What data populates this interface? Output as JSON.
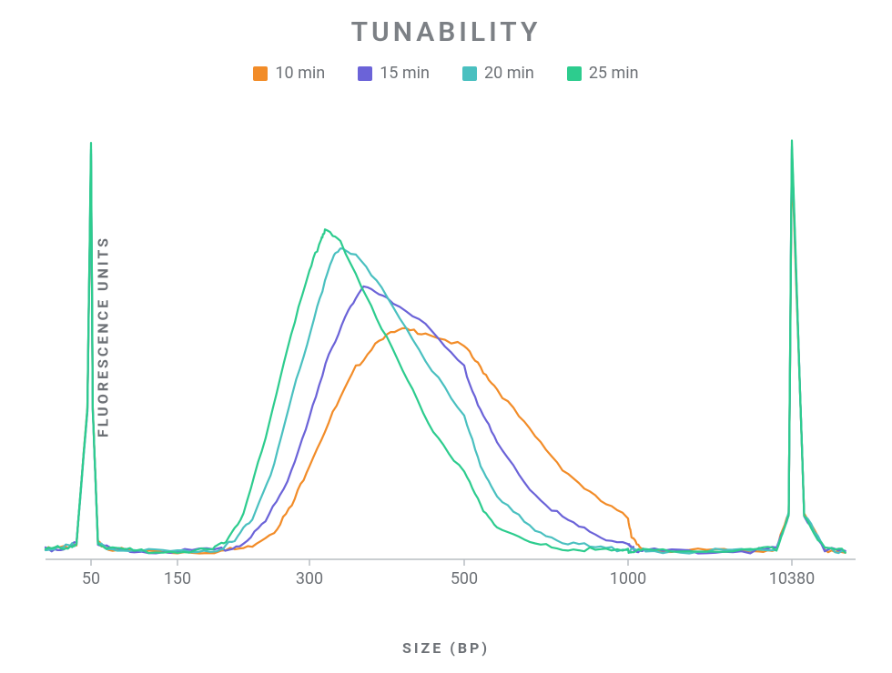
{
  "chart_data": {
    "type": "line",
    "title": "TUNABILITY",
    "xlabel": "SIZE (BP)",
    "ylabel": "FLUORESCENCE UNITS",
    "x_ticks": [
      50,
      150,
      300,
      500,
      1000,
      10380
    ],
    "x_scale_note": "x positions are approximate log-like mapping of bp size to chart x",
    "legend_position": "top",
    "y_range": [
      0,
      1.0
    ],
    "series": [
      {
        "name": "10 min",
        "color": "#f28c28",
        "peak_bp": 420,
        "peak_rel_height": 0.54,
        "data": [
          [
            25,
            0.015
          ],
          [
            35,
            0.02
          ],
          [
            42,
            0.03
          ],
          [
            48,
            0.35
          ],
          [
            50,
            0.95
          ],
          [
            52,
            0.35
          ],
          [
            58,
            0.03
          ],
          [
            70,
            0.018
          ],
          [
            100,
            0.012
          ],
          [
            150,
            0.01
          ],
          [
            200,
            0.012
          ],
          [
            230,
            0.02
          ],
          [
            260,
            0.06
          ],
          [
            280,
            0.12
          ],
          [
            300,
            0.22
          ],
          [
            330,
            0.34
          ],
          [
            360,
            0.45
          ],
          [
            390,
            0.52
          ],
          [
            420,
            0.54
          ],
          [
            450,
            0.535
          ],
          [
            500,
            0.5
          ],
          [
            550,
            0.45
          ],
          [
            600,
            0.4
          ],
          [
            700,
            0.3
          ],
          [
            800,
            0.21
          ],
          [
            900,
            0.14
          ],
          [
            1000,
            0.09
          ],
          [
            1200,
            0.05
          ],
          [
            1500,
            0.025
          ],
          [
            2000,
            0.015
          ],
          [
            5000,
            0.012
          ],
          [
            8000,
            0.012
          ],
          [
            9500,
            0.018
          ],
          [
            10200,
            0.1
          ],
          [
            10380,
            0.95
          ],
          [
            10500,
            0.1
          ],
          [
            10700,
            0.015
          ],
          [
            10900,
            0.012
          ]
        ]
      },
      {
        "name": "15 min",
        "color": "#6b63d8",
        "peak_bp": 370,
        "peak_rel_height": 0.64,
        "data": [
          [
            25,
            0.015
          ],
          [
            35,
            0.02
          ],
          [
            42,
            0.03
          ],
          [
            48,
            0.35
          ],
          [
            50,
            0.96
          ],
          [
            52,
            0.35
          ],
          [
            58,
            0.03
          ],
          [
            70,
            0.018
          ],
          [
            100,
            0.012
          ],
          [
            150,
            0.01
          ],
          [
            200,
            0.015
          ],
          [
            225,
            0.03
          ],
          [
            250,
            0.08
          ],
          [
            275,
            0.18
          ],
          [
            300,
            0.33
          ],
          [
            325,
            0.48
          ],
          [
            350,
            0.59
          ],
          [
            370,
            0.64
          ],
          [
            400,
            0.62
          ],
          [
            450,
            0.55
          ],
          [
            500,
            0.45
          ],
          [
            550,
            0.35
          ],
          [
            600,
            0.27
          ],
          [
            700,
            0.16
          ],
          [
            800,
            0.09
          ],
          [
            900,
            0.05
          ],
          [
            1000,
            0.03
          ],
          [
            1200,
            0.018
          ],
          [
            1500,
            0.013
          ],
          [
            2000,
            0.012
          ],
          [
            5000,
            0.012
          ],
          [
            8000,
            0.012
          ],
          [
            9500,
            0.018
          ],
          [
            10200,
            0.1
          ],
          [
            10380,
            0.97
          ],
          [
            10500,
            0.1
          ],
          [
            10700,
            0.015
          ],
          [
            10900,
            0.012
          ]
        ]
      },
      {
        "name": "20 min",
        "color": "#4ac0c0",
        "peak_bp": 340,
        "peak_rel_height": 0.74,
        "data": [
          [
            25,
            0.015
          ],
          [
            35,
            0.02
          ],
          [
            42,
            0.03
          ],
          [
            48,
            0.35
          ],
          [
            50,
            0.97
          ],
          [
            52,
            0.35
          ],
          [
            58,
            0.03
          ],
          [
            70,
            0.018
          ],
          [
            100,
            0.012
          ],
          [
            150,
            0.01
          ],
          [
            195,
            0.015
          ],
          [
            215,
            0.035
          ],
          [
            235,
            0.09
          ],
          [
            260,
            0.22
          ],
          [
            285,
            0.42
          ],
          [
            310,
            0.6
          ],
          [
            330,
            0.71
          ],
          [
            340,
            0.74
          ],
          [
            360,
            0.72
          ],
          [
            400,
            0.62
          ],
          [
            450,
            0.47
          ],
          [
            500,
            0.33
          ],
          [
            550,
            0.22
          ],
          [
            600,
            0.14
          ],
          [
            700,
            0.07
          ],
          [
            800,
            0.035
          ],
          [
            900,
            0.02
          ],
          [
            1000,
            0.015
          ],
          [
            1200,
            0.012
          ],
          [
            2000,
            0.012
          ],
          [
            5000,
            0.012
          ],
          [
            8000,
            0.012
          ],
          [
            9500,
            0.018
          ],
          [
            10200,
            0.1
          ],
          [
            10380,
            0.98
          ],
          [
            10500,
            0.1
          ],
          [
            10700,
            0.015
          ],
          [
            10900,
            0.012
          ]
        ]
      },
      {
        "name": "25 min",
        "color": "#2dcc8e",
        "peak_bp": 320,
        "peak_rel_height": 0.78,
        "data": [
          [
            25,
            0.015
          ],
          [
            35,
            0.02
          ],
          [
            42,
            0.03
          ],
          [
            48,
            0.35
          ],
          [
            50,
            0.99
          ],
          [
            52,
            0.35
          ],
          [
            58,
            0.03
          ],
          [
            70,
            0.018
          ],
          [
            100,
            0.012
          ],
          [
            150,
            0.01
          ],
          [
            190,
            0.015
          ],
          [
            205,
            0.035
          ],
          [
            225,
            0.1
          ],
          [
            250,
            0.28
          ],
          [
            275,
            0.5
          ],
          [
            300,
            0.68
          ],
          [
            315,
            0.76
          ],
          [
            320,
            0.78
          ],
          [
            340,
            0.75
          ],
          [
            380,
            0.6
          ],
          [
            420,
            0.44
          ],
          [
            460,
            0.3
          ],
          [
            500,
            0.2
          ],
          [
            550,
            0.12
          ],
          [
            600,
            0.07
          ],
          [
            700,
            0.03
          ],
          [
            800,
            0.018
          ],
          [
            900,
            0.014
          ],
          [
            1000,
            0.012
          ],
          [
            1200,
            0.012
          ],
          [
            2000,
            0.012
          ],
          [
            5000,
            0.012
          ],
          [
            8000,
            0.012
          ],
          [
            9500,
            0.018
          ],
          [
            10200,
            0.1
          ],
          [
            10380,
            0.99
          ],
          [
            10500,
            0.1
          ],
          [
            10700,
            0.015
          ],
          [
            10900,
            0.012
          ]
        ]
      }
    ]
  },
  "ui": {
    "title": "TUNABILITY",
    "xlabel": "SIZE (BP)",
    "ylabel": "FLUORESCENCE UNITS",
    "legend": [
      "10 min",
      "15 min",
      "20 min",
      "25 min"
    ]
  }
}
